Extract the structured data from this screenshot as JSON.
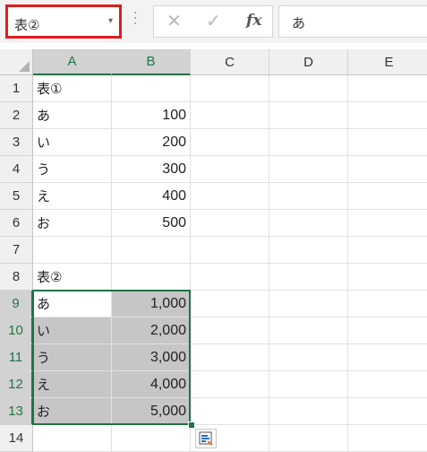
{
  "formula_bar": {
    "name_box": "表②",
    "name_box_dropdown": "▾",
    "cancel_icon": "✕",
    "enter_icon": "✓",
    "fx_label": "fx",
    "formula_value": "あ"
  },
  "sheet": {
    "columns": [
      "A",
      "B",
      "C",
      "D",
      "E"
    ],
    "rows": [
      {
        "n": "1",
        "a": "表①",
        "b": ""
      },
      {
        "n": "2",
        "a": "あ",
        "b": "100"
      },
      {
        "n": "3",
        "a": "い",
        "b": "200"
      },
      {
        "n": "4",
        "a": "う",
        "b": "300"
      },
      {
        "n": "5",
        "a": "え",
        "b": "400"
      },
      {
        "n": "6",
        "a": "お",
        "b": "500"
      },
      {
        "n": "7",
        "a": "",
        "b": ""
      },
      {
        "n": "8",
        "a": "表②",
        "b": ""
      },
      {
        "n": "9",
        "a": "あ",
        "b": "1,000"
      },
      {
        "n": "10",
        "a": "い",
        "b": "2,000"
      },
      {
        "n": "11",
        "a": "う",
        "b": "3,000"
      },
      {
        "n": "12",
        "a": "え",
        "b": "4,000"
      },
      {
        "n": "13",
        "a": "お",
        "b": "5,000"
      },
      {
        "n": "14",
        "a": "",
        "b": ""
      }
    ],
    "selection": "A9:B13",
    "active_cell": "A9",
    "selection_color": "#217346",
    "highlight_color": "#c6c6c6",
    "namebox_outline_color": "#e01c1c"
  }
}
